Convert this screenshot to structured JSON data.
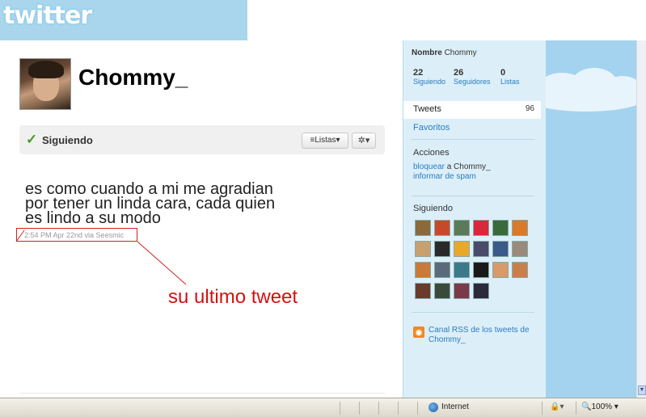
{
  "header": {
    "logo_text": "twitter"
  },
  "profile": {
    "username": "Chommy_",
    "following_label": "Siguiendo",
    "lists_button": "≡Listas▾",
    "gear_button": "✲▾"
  },
  "tweet": {
    "line1": "es como cuando a mi me agradian",
    "line2": "por tener un linda cara, cada quien",
    "line3": "es lindo a su modo",
    "meta": "2:54 PM Apr 22nd via Seesmic"
  },
  "annotation": {
    "text": "su ultimo tweet"
  },
  "sidebar": {
    "name_label": "Nombre",
    "name_value": "Chommy",
    "stats": [
      {
        "value": "22",
        "label": "Siguiendo"
      },
      {
        "value": "26",
        "label": "Seguidores"
      },
      {
        "value": "0",
        "label": "Listas"
      }
    ],
    "tweets_label": "Tweets",
    "tweets_count": "96",
    "favorites": "Favoritos",
    "actions_title": "Acciones",
    "block_link": "bloquear",
    "block_target": "a Chommy_",
    "report_link": "informar de spam",
    "following_title": "Siguiendo",
    "rss_text": "Canal RSS de los tweets de Chommy_"
  },
  "statusbar": {
    "zone": "Internet",
    "lock": "🔒▾",
    "zoom": "🔍100%  ▾"
  },
  "colors": {
    "accent_blue": "#2a7cc0",
    "sidebar_bg": "#dceff8",
    "annotation_red": "#d41010",
    "check_green": "#4a9b2a"
  }
}
